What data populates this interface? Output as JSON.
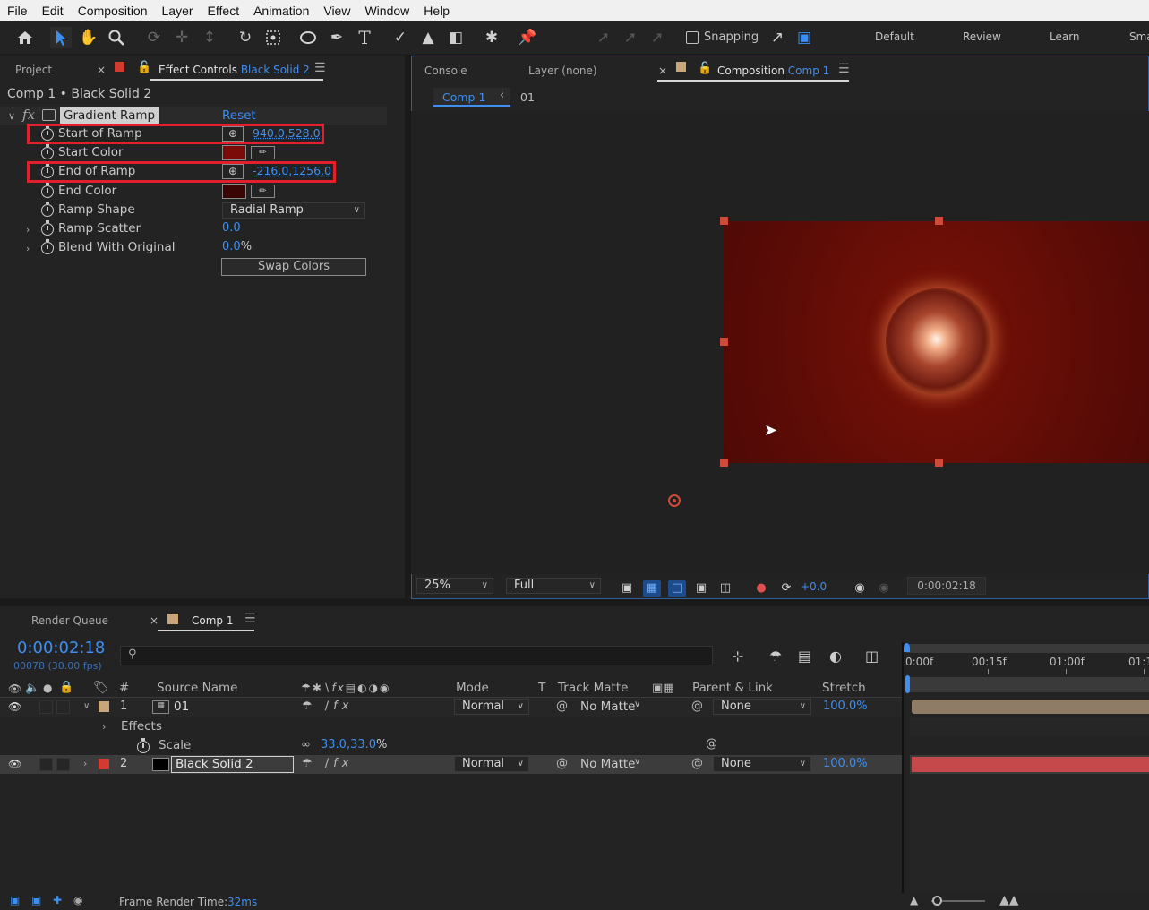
{
  "menu": [
    "File",
    "Edit",
    "Composition",
    "Layer",
    "Effect",
    "Animation",
    "View",
    "Window",
    "Help"
  ],
  "toolbar": {
    "snapping_label": "Snapping",
    "workspaces": [
      "Default",
      "Review",
      "Learn",
      "Sma"
    ]
  },
  "left_panel": {
    "tabs": {
      "project": "Project",
      "effect_controls_prefix": "Effect Controls",
      "effect_controls_layer": "Black Solid 2"
    },
    "breadcrumb": "Comp 1 • Black Solid 2",
    "effect": {
      "fx_label": "fx",
      "name": "Gradient Ramp",
      "reset": "Reset",
      "properties": {
        "start_of_ramp": {
          "label": "Start of Ramp",
          "value": "940.0,528.0"
        },
        "start_color": {
          "label": "Start Color",
          "color": "#7a0b08"
        },
        "end_of_ramp": {
          "label": "End of Ramp",
          "value": "-216.0,1256.0"
        },
        "end_color": {
          "label": "End Color",
          "color": "#3a0605"
        },
        "ramp_shape": {
          "label": "Ramp Shape",
          "value": "Radial Ramp"
        },
        "ramp_scatter": {
          "label": "Ramp Scatter",
          "value": "0.0"
        },
        "blend_with_original": {
          "label": "Blend With Original",
          "value": "0.0",
          "unit": "%"
        }
      },
      "swap_colors": "Swap Colors"
    }
  },
  "right_panel": {
    "tabs": {
      "console": "Console",
      "layer": "Layer (none)",
      "composition_prefix": "Composition",
      "composition_name": "Comp 1"
    },
    "breadcrumbs": {
      "comp": "Comp 1",
      "layer": "01"
    },
    "footer": {
      "zoom": "25%",
      "resolution": "Full",
      "exposure": "+0.0",
      "timecode": "0:00:02:18"
    }
  },
  "timeline": {
    "tabs": {
      "render_queue": "Render Queue",
      "comp": "Comp 1"
    },
    "current_time": "0:00:02:18",
    "frame_info": "00078 (30.00 fps)",
    "search_icon": "search-icon",
    "columns": {
      "num": "#",
      "source_name": "Source Name",
      "mode": "Mode",
      "t": "T",
      "track_matte": "Track Matte",
      "parent_link": "Parent & Link",
      "stretch": "Stretch"
    },
    "ruler": [
      "0:00f",
      "00:15f",
      "01:00f",
      "01:1"
    ],
    "layers": [
      {
        "index": "1",
        "name": "01",
        "mode": "Normal",
        "matte": "No Matte",
        "parent": "None",
        "stretch": "100.0%",
        "label_color": "#c9a57a"
      },
      {
        "index": "2",
        "name": "Black Solid 2",
        "mode": "Normal",
        "matte": "No Matte",
        "parent": "None",
        "stretch": "100.0%",
        "label_color": "#d23b30"
      }
    ],
    "effects_label": "Effects",
    "scale": {
      "label": "Scale",
      "value": "33.0,33.0",
      "unit": "%"
    },
    "status": {
      "label": "Frame Render Time:",
      "value": "32ms"
    }
  }
}
